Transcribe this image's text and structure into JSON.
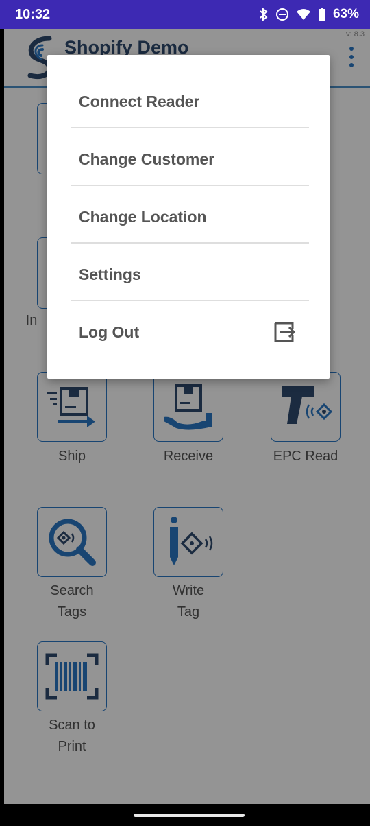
{
  "status_bar": {
    "time": "10:32",
    "battery": "63%",
    "icons": [
      "bluetooth-icon",
      "do-not-disturb-icon",
      "wifi-icon",
      "battery-icon"
    ]
  },
  "header": {
    "title": "Shopify Demo",
    "version": "v: 8.3",
    "menu_icon": "more-vert-icon"
  },
  "tiles": [
    {
      "name": "ship",
      "label": "Ship",
      "icon": "ship-icon"
    },
    {
      "name": "receive",
      "label": "Receive",
      "icon": "receive-icon"
    },
    {
      "name": "epc-read",
      "label": "EPC Read",
      "icon": "rfid-reader-icon"
    },
    {
      "name": "search-tags",
      "label_line1": "Search",
      "label_line2": "Tags",
      "icon": "search-tag-icon"
    },
    {
      "name": "write-tag",
      "label_line1": "Write",
      "label_line2": "Tag",
      "icon": "write-tag-icon"
    },
    {
      "name": "scan-to-print",
      "label_line1": "Scan to",
      "label_line2": "Print",
      "icon": "barcode-scan-icon"
    }
  ],
  "partial_tile_label": "In",
  "menu": {
    "items": [
      {
        "label": "Connect Reader"
      },
      {
        "label": "Change Customer"
      },
      {
        "label": "Change Location"
      },
      {
        "label": "Settings"
      },
      {
        "label": "Log Out",
        "icon": "logout-icon"
      }
    ]
  },
  "colors": {
    "status_bar": "#3d29b3",
    "accent": "#2a77c4",
    "title": "#2f4a6e"
  }
}
